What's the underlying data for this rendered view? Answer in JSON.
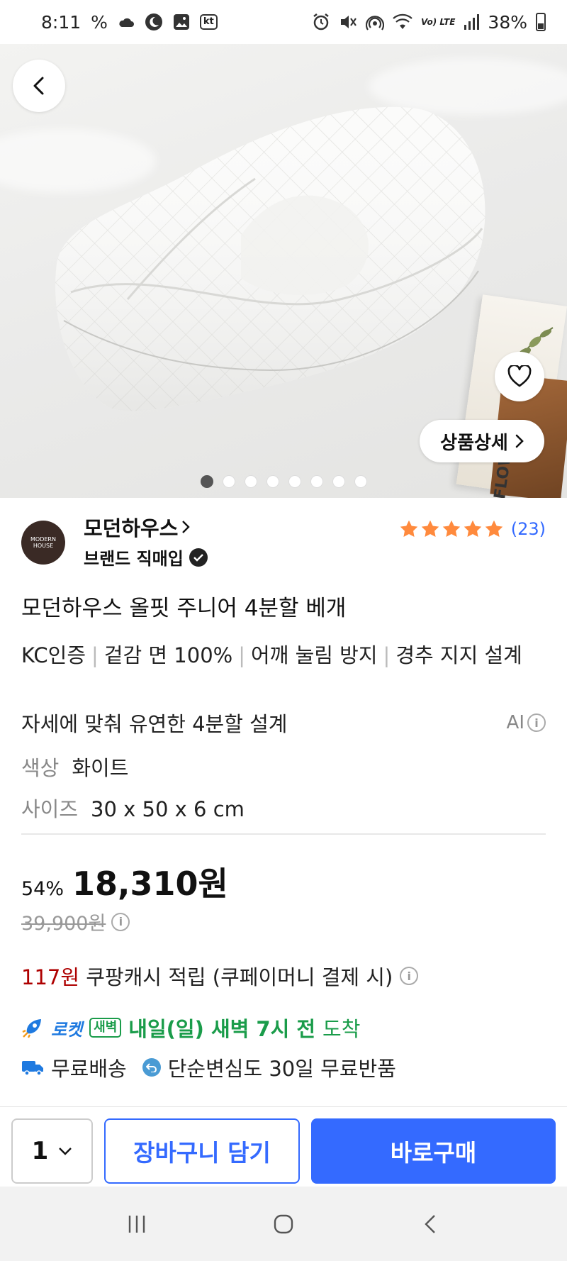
{
  "status_bar": {
    "time": "8:11",
    "carrier_badge": "kt",
    "volte": "Vo) LTE",
    "battery": "38%"
  },
  "hero": {
    "image_count": 8,
    "active_index": 0,
    "detail_label": "상품상세",
    "book_spine_text": "FLOW"
  },
  "seller": {
    "name": "모던하우스",
    "subtitle": "브랜드 직매입",
    "logo_text": "MODERN HOUSE",
    "rating_stars": 5,
    "review_count": "(23)"
  },
  "product": {
    "title": "모던하우스 올핏 주니어 4분할 베개",
    "features": [
      "KC인증",
      "겉감 면 100%",
      "어깨 눌림 방지",
      "경추 지지 설계"
    ],
    "ai_summary": "자세에 맞춰 유연한 4분할 설계",
    "ai_label": "AI",
    "options": [
      {
        "key": "색상",
        "value": "화이트"
      },
      {
        "key": "사이즈",
        "value": "30 x 50 x 6 cm"
      }
    ]
  },
  "price": {
    "discount": "54%",
    "sale": "18,310원",
    "original": "39,900원"
  },
  "cash": {
    "amount": "117원",
    "text": "쿠팡캐시 적립 (쿠페이머니 결제 시)"
  },
  "delivery": {
    "rocket_label": "로켓",
    "dawn_tag": "새벽",
    "arrive_text": "내일(일) 새벽 7시 전",
    "arrive_suffix": "도착",
    "free_shipping": "무료배송",
    "free_return": "단순변심도 30일 무료반품"
  },
  "bottom": {
    "quantity": "1",
    "cart_label": "장바구니 담기",
    "buy_label": "바로구매"
  },
  "colors": {
    "accent": "#346aff",
    "star": "#ff8a3d",
    "cash_red": "#ae0000",
    "dawn_green": "#1a9c4a"
  }
}
